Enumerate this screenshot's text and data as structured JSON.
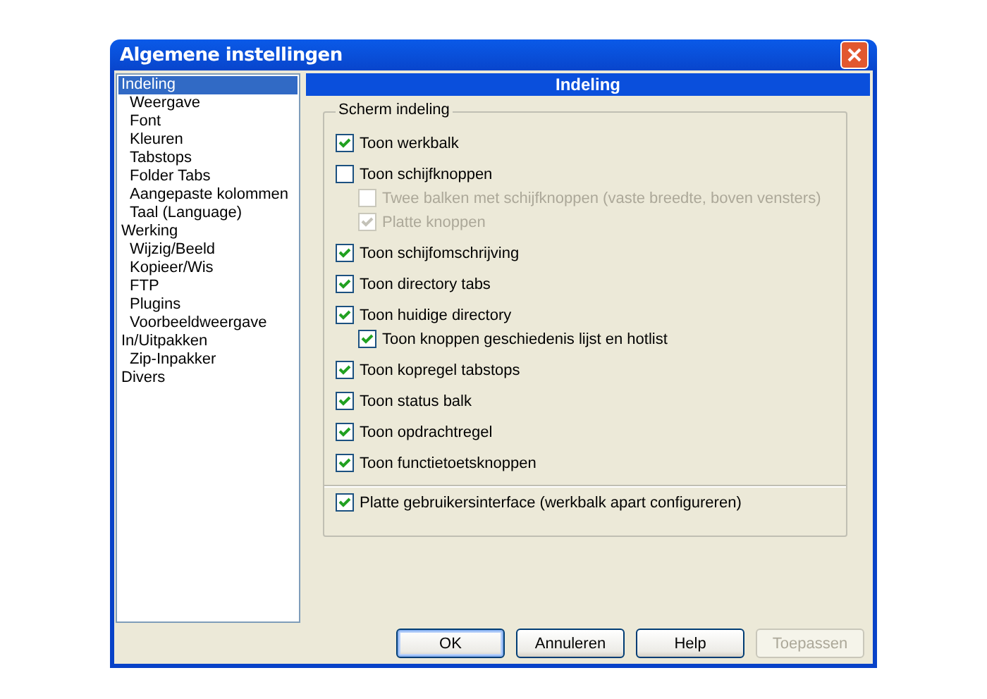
{
  "window": {
    "title": "Algemene instellingen"
  },
  "sidebar": {
    "items": [
      {
        "label": "Indeling",
        "selected": true,
        "children": [
          {
            "label": "Weergave",
            "selected": false
          },
          {
            "label": "Font",
            "selected": false
          },
          {
            "label": "Kleuren",
            "selected": false
          },
          {
            "label": "Tabstops",
            "selected": false
          },
          {
            "label": "Folder Tabs",
            "selected": false
          },
          {
            "label": "Aangepaste kolommen",
            "selected": false
          },
          {
            "label": "Taal (Language)",
            "selected": false
          }
        ]
      },
      {
        "label": "Werking",
        "selected": false,
        "children": [
          {
            "label": "Wijzig/Beeld",
            "selected": false
          },
          {
            "label": "Kopieer/Wis",
            "selected": false
          },
          {
            "label": "FTP",
            "selected": false
          },
          {
            "label": "Plugins",
            "selected": false
          },
          {
            "label": "Voorbeeldweergave",
            "selected": false
          }
        ]
      },
      {
        "label": "In/Uitpakken",
        "selected": false,
        "children": [
          {
            "label": "Zip-Inpakker",
            "selected": false
          }
        ]
      },
      {
        "label": "Divers",
        "selected": false
      }
    ]
  },
  "panel": {
    "title": "Indeling",
    "group": {
      "title": "Scherm indeling",
      "options": [
        {
          "label": "Toon werkbalk",
          "checked": true,
          "disabled": false
        },
        {
          "label": "Toon schijfknoppen",
          "checked": false,
          "disabled": false,
          "children": [
            {
              "label": "Twee balken met schijfknoppen (vaste breedte, boven vensters)",
              "checked": false,
              "disabled": true
            },
            {
              "label": "Platte knoppen",
              "checked": true,
              "disabled": true
            }
          ]
        },
        {
          "label": "Toon schijfomschrijving",
          "checked": true,
          "disabled": false
        },
        {
          "label": "Toon directory tabs",
          "checked": true,
          "disabled": false
        },
        {
          "label": "Toon huidige directory",
          "checked": true,
          "disabled": false,
          "children": [
            {
              "label": "Toon knoppen geschiedenis lijst en hotlist",
              "checked": true,
              "disabled": false
            }
          ]
        },
        {
          "label": "Toon kopregel tabstops",
          "checked": true,
          "disabled": false
        },
        {
          "label": "Toon status balk",
          "checked": true,
          "disabled": false
        },
        {
          "label": "Toon opdrachtregel",
          "checked": true,
          "disabled": false
        },
        {
          "label": "Toon functietoetsknoppen",
          "checked": true,
          "disabled": false
        }
      ],
      "footer_options": [
        {
          "label": "Platte gebruikersinterface (werkbalk apart configureren)",
          "checked": true,
          "disabled": false
        }
      ]
    }
  },
  "buttons": [
    {
      "label": "OK",
      "default": true,
      "disabled": false
    },
    {
      "label": "Annuleren",
      "default": false,
      "disabled": false
    },
    {
      "label": "Help",
      "default": false,
      "disabled": false
    },
    {
      "label": "Toepassen",
      "default": false,
      "disabled": true
    }
  ]
}
